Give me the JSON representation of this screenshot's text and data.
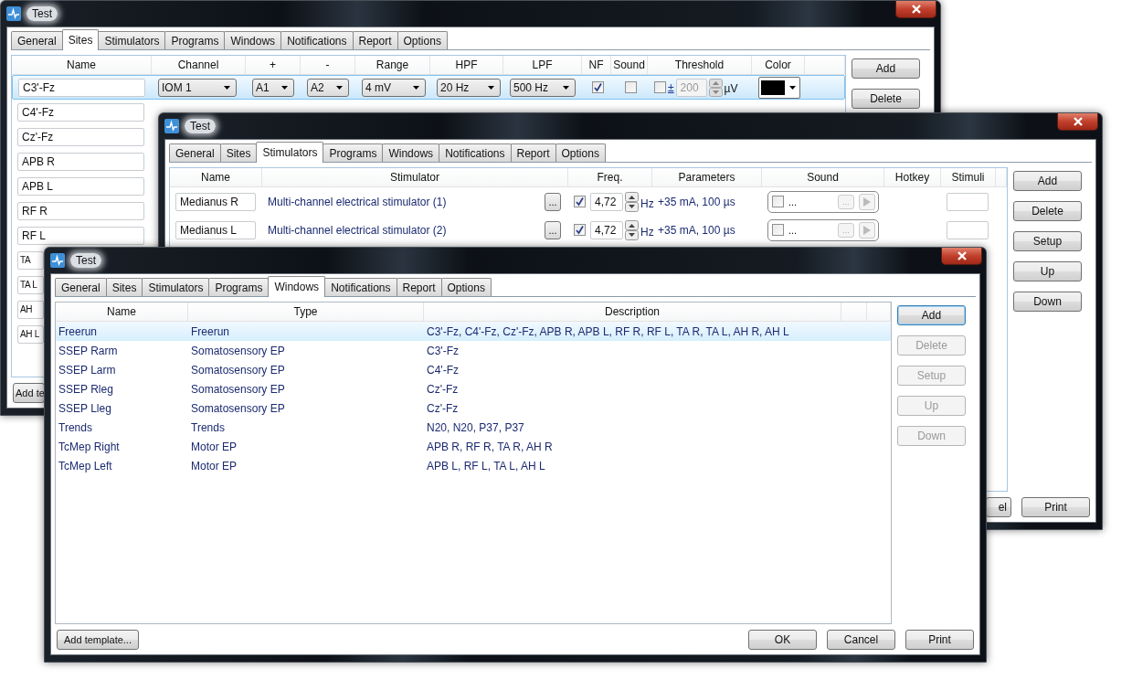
{
  "sites_window": {
    "title": "Test",
    "tabs": [
      {
        "label": "General",
        "selected": false
      },
      {
        "label": "Sites",
        "selected": true
      },
      {
        "label": "Stimulators",
        "selected": false
      },
      {
        "label": "Programs",
        "selected": false
      },
      {
        "label": "Windows",
        "selected": false
      },
      {
        "label": "Notifications",
        "selected": false
      },
      {
        "label": "Report",
        "selected": false
      },
      {
        "label": "Options",
        "selected": false
      }
    ],
    "columns": [
      "Name",
      "Channel",
      "+",
      "-",
      "Range",
      "HPF",
      "LPF",
      "NF",
      "Sound",
      "Threshold",
      "Color"
    ],
    "rows": [
      {
        "name": "C3'-Fz",
        "channel": "IOM 1",
        "plus": "A1",
        "minus": "A2",
        "range": "4 mV",
        "hpf": "20 Hz",
        "lpf": "500 Hz",
        "nf": true,
        "sound": false,
        "threshold_on": false,
        "sign": "±",
        "threshold": "200",
        "unit": "µV",
        "color": "#000000",
        "selected": true
      }
    ],
    "more_sites": [
      "C4'-Fz",
      "Cz'-Fz",
      "APB R",
      "APB L",
      "RF R",
      "RF L",
      "TA",
      "TA L",
      "AH",
      "AH L"
    ],
    "buttons": [
      "Add",
      "Delete"
    ],
    "add_button": "Add te"
  },
  "stimulators_window": {
    "title": "Test",
    "tabs": [
      {
        "label": "General",
        "selected": false
      },
      {
        "label": "Sites",
        "selected": false
      },
      {
        "label": "Stimulators",
        "selected": true
      },
      {
        "label": "Programs",
        "selected": false
      },
      {
        "label": "Windows",
        "selected": false
      },
      {
        "label": "Notifications",
        "selected": false
      },
      {
        "label": "Report",
        "selected": false
      },
      {
        "label": "Options",
        "selected": false
      }
    ],
    "columns": [
      "Name",
      "Stimulator",
      "Freq.",
      "Parameters",
      "Sound",
      "Hotkey",
      "Stimuli"
    ],
    "rows": [
      {
        "name": "Medianus R",
        "stimulator": "Multi-channel electrical stimulator (1)",
        "browse": "...",
        "freq_on": true,
        "freq": "4,72",
        "unit": "Hz",
        "parameters": "+35 mA, 100 µs",
        "sound_on": false,
        "sound": "...",
        "sound_browse": "..."
      },
      {
        "name": "Medianus L",
        "stimulator": "Multi-channel electrical stimulator (2)",
        "browse": "...",
        "freq_on": true,
        "freq": "4,72",
        "unit": "Hz",
        "parameters": "+35 mA, 100 µs",
        "sound_on": false,
        "sound": "...",
        "sound_browse": "..."
      }
    ],
    "buttons": [
      "Add",
      "Delete",
      "Setup",
      "Up",
      "Down"
    ],
    "bottom_buttons": [
      "el",
      "Print"
    ]
  },
  "windows_window": {
    "title": "Test",
    "tabs": [
      {
        "label": "General",
        "selected": false
      },
      {
        "label": "Sites",
        "selected": false
      },
      {
        "label": "Stimulators",
        "selected": false
      },
      {
        "label": "Programs",
        "selected": false
      },
      {
        "label": "Windows",
        "selected": true
      },
      {
        "label": "Notifications",
        "selected": false
      },
      {
        "label": "Report",
        "selected": false
      },
      {
        "label": "Options",
        "selected": false
      }
    ],
    "columns": [
      "Name",
      "Type",
      "Description"
    ],
    "rows": [
      {
        "name": "Freerun",
        "type": "Freerun",
        "description": "C3'-Fz, C4'-Fz, Cz'-Fz, APB R, APB L, RF R, RF L, TA R, TA L, AH R, AH L",
        "selected": true
      },
      {
        "name": "SSEP Rarm",
        "type": "Somatosensory EP",
        "description": "C3'-Fz",
        "selected": false
      },
      {
        "name": "SSEP Larm",
        "type": "Somatosensory EP",
        "description": "C4'-Fz",
        "selected": false
      },
      {
        "name": "SSEP Rleg",
        "type": "Somatosensory EP",
        "description": "Cz'-Fz",
        "selected": false
      },
      {
        "name": "SSEP Lleg",
        "type": "Somatosensory EP",
        "description": "Cz'-Fz",
        "selected": false
      },
      {
        "name": "Trends",
        "type": "Trends",
        "description": "N20, N20, P37, P37",
        "selected": false
      },
      {
        "name": "TcMep Right",
        "type": "Motor EP",
        "description": "APB R, RF R, TA R, AH R",
        "selected": false
      },
      {
        "name": "TcMep Left",
        "type": "Motor EP",
        "description": "APB L, RF L, TA L, AH L",
        "selected": false
      }
    ],
    "buttons": [
      {
        "label": "Add",
        "disabled": false,
        "focused": true
      },
      {
        "label": "Delete",
        "disabled": true,
        "focused": false
      },
      {
        "label": "Setup",
        "disabled": true,
        "focused": false
      },
      {
        "label": "Up",
        "disabled": true,
        "focused": false
      },
      {
        "label": "Down",
        "disabled": true,
        "focused": false
      }
    ],
    "add_button": "Add template...",
    "bottom_buttons": [
      "OK",
      "Cancel",
      "Print"
    ]
  }
}
